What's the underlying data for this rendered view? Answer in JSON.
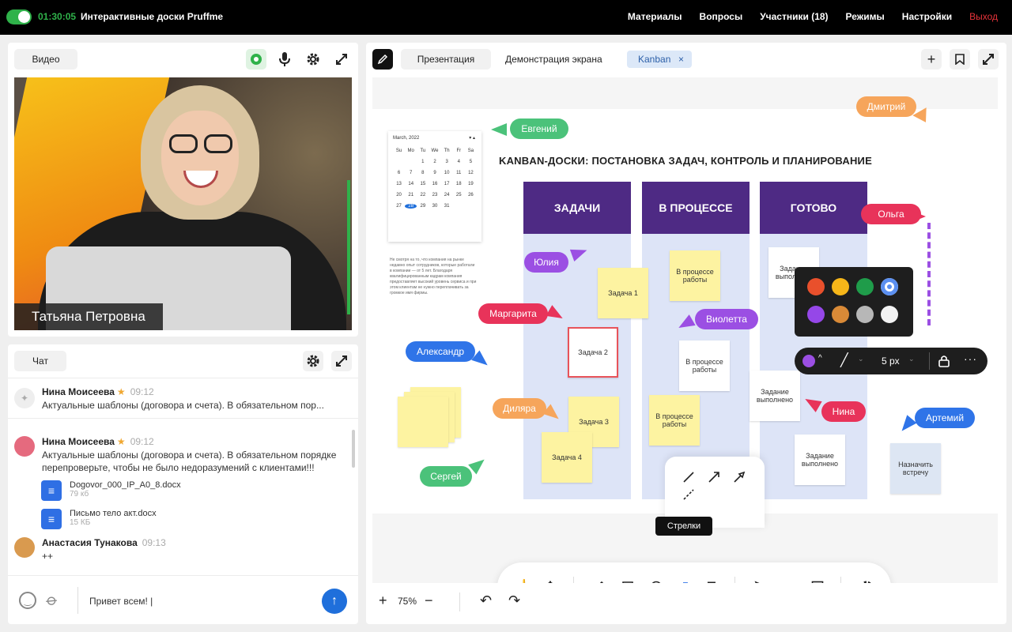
{
  "topbar": {
    "timer": "01:30:05",
    "title": "Интерактивные доски Pruffme",
    "nav": [
      "Материалы",
      "Вопросы",
      "Участники (18)",
      "Режимы",
      "Настройки"
    ],
    "exit": "Выход"
  },
  "video": {
    "tab_label": "Видео",
    "speaker_name": "Татьяна Петровна",
    "icons": [
      "camera-icon",
      "mic-icon",
      "gear-icon",
      "expand-icon"
    ]
  },
  "chat": {
    "tab_label": "Чат",
    "pinned": {
      "name": "Нина Моисеева",
      "time": "09:12",
      "text": "Актуальные шаблоны (договора и счета). В обязательном пор..."
    },
    "messages": [
      {
        "name": "Нина Моисеева",
        "time": "09:12",
        "text": "Актуальные шаблоны (договора и счета). В обязательном порядке перепроверьте, чтобы не было недоразумений с клиентами!!!"
      },
      {
        "name": "Анастасия Тунакова",
        "time": "09:13",
        "text": "++"
      }
    ],
    "files": [
      {
        "name": "Dogovor_000_IP_A0_8.docx",
        "size": "79 кб"
      },
      {
        "name": "Письмо тело акт.docx",
        "size": "15 КБ"
      }
    ],
    "input_value": "Привет всем! |"
  },
  "board": {
    "tabs": [
      "Презентация",
      "Демонстрация экрана"
    ],
    "active_tab": "Kanban",
    "title": "KANBAN-ДОСКИ: ПОСТАНОВКА ЗАДАЧ, КОНТРОЛЬ И ПЛАНИРОВАНИЕ",
    "columns": [
      "ЗАДАЧИ",
      "В ПРОЦЕССЕ",
      "ГОТОВО"
    ],
    "stickies": {
      "todo": [
        "Задача 1",
        "Задача 2",
        "Задача 3",
        "Задача 4"
      ],
      "progress": [
        "В процессе работы",
        "В процессе работы",
        "В процессе работы"
      ],
      "done": [
        "Задание выполнено",
        "Задание выполнено",
        "Задание выполнено"
      ],
      "extra": "Назначить встречу"
    },
    "cursors": [
      "Евгений",
      "Дмитрий",
      "Юлия",
      "Ольга",
      "Маргарита",
      "Виолетта",
      "Александр",
      "Диляра",
      "Нина",
      "Артемий",
      "Сергей"
    ],
    "calendar": {
      "month": "March, 2022",
      "weekdays": [
        "Su",
        "Mo",
        "Tu",
        "We",
        "Th",
        "Fr",
        "Sa"
      ],
      "days": [
        "",
        "",
        "1",
        "2",
        "3",
        "4",
        "5",
        "6",
        "7",
        "8",
        "9",
        "10",
        "11",
        "12",
        "13",
        "14",
        "15",
        "16",
        "17",
        "18",
        "19",
        "20",
        "21",
        "22",
        "23",
        "24",
        "25",
        "26",
        "27",
        "28",
        "29",
        "30",
        "31",
        "",
        ""
      ],
      "today": "28"
    },
    "tiny_text": "Не смотря на то, что компания на рынке недавно опыт сотрудников, которые работали в компании — от 5 лет. Благодаря квалифицированным кадрам компания предоставляет высокий уровень сервиса и при этом клиентам не нужно переплачивать за громкое имя фирмы.",
    "colors": [
      "#e9502c",
      "#f6b619",
      "#1f9c4a",
      "#5b8ff0",
      "#9547e8",
      "#d98a37",
      "#b7b7b7",
      "#f2f2f2"
    ],
    "stroke_size": "5 px",
    "tooltip": "Стрелки",
    "zoom": "75%"
  }
}
